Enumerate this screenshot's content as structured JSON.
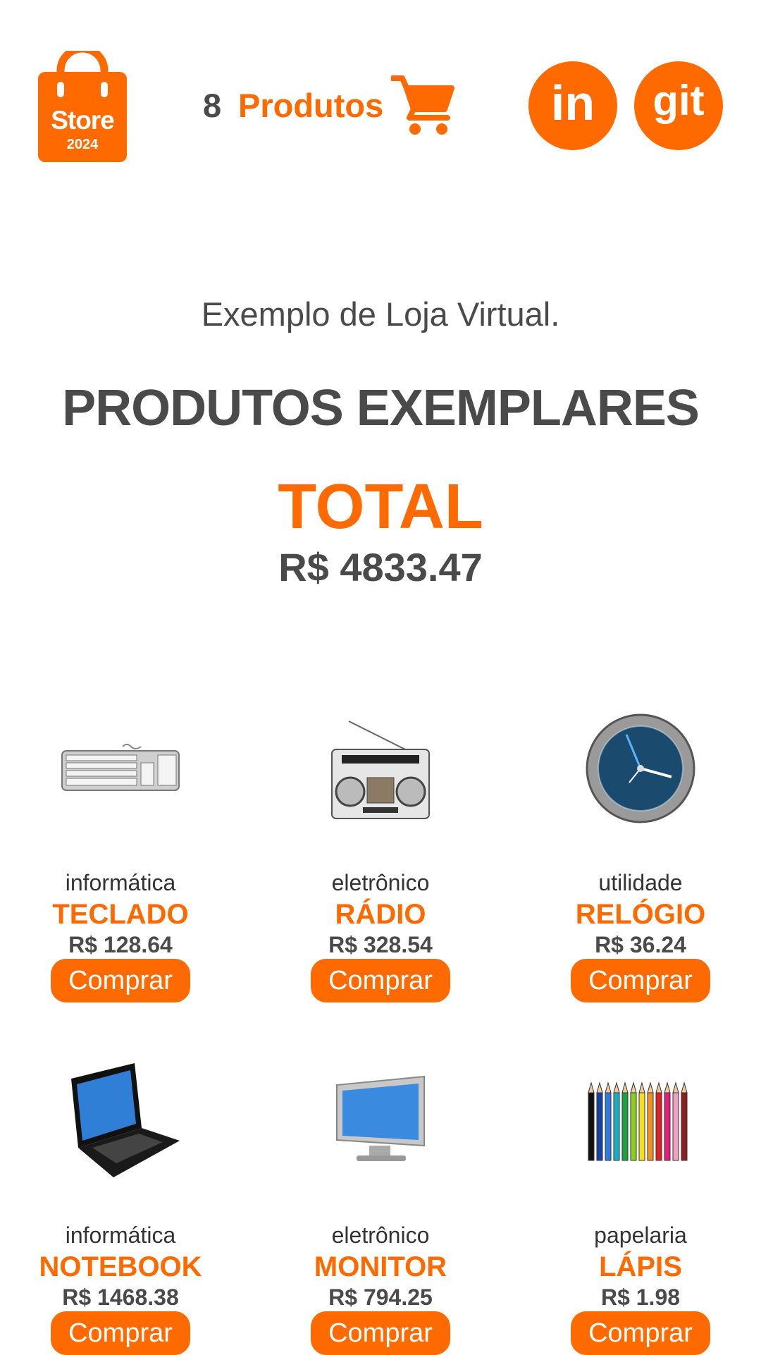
{
  "header": {
    "logo_text": "Store",
    "logo_year": "2024",
    "cart_count": "8",
    "cart_label": "Produtos",
    "social_linkedin": "in",
    "social_git": "git"
  },
  "hero": {
    "subtitle": "Exemplo de Loja Virtual.",
    "headline": "PRODUTOS EXEMPLARES",
    "total_label": "TOTAL",
    "total_value": "R$ 4833.47"
  },
  "products": [
    {
      "category": "informática",
      "name": "TECLADO",
      "price": "R$ 128.64",
      "button": "Comprar",
      "icon": "keyboard-icon"
    },
    {
      "category": "eletrônico",
      "name": "RÁDIO",
      "price": "R$ 328.54",
      "button": "Comprar",
      "icon": "radio-icon"
    },
    {
      "category": "utilidade",
      "name": "RELÓGIO",
      "price": "R$ 36.24",
      "button": "Comprar",
      "icon": "clock-icon"
    },
    {
      "category": "informática",
      "name": "NOTEBOOK",
      "price": "R$ 1468.38",
      "button": "Comprar",
      "icon": "laptop-icon"
    },
    {
      "category": "eletrônico",
      "name": "MONITOR",
      "price": "R$ 794.25",
      "button": "Comprar",
      "icon": "monitor-icon"
    },
    {
      "category": "papelaria",
      "name": "LÁPIS",
      "price": "R$ 1.98",
      "button": "Comprar",
      "icon": "pencils-icon"
    }
  ],
  "colors": {
    "accent": "#ff6a00",
    "text": "#4a4a4a",
    "background": "#ffffff"
  }
}
